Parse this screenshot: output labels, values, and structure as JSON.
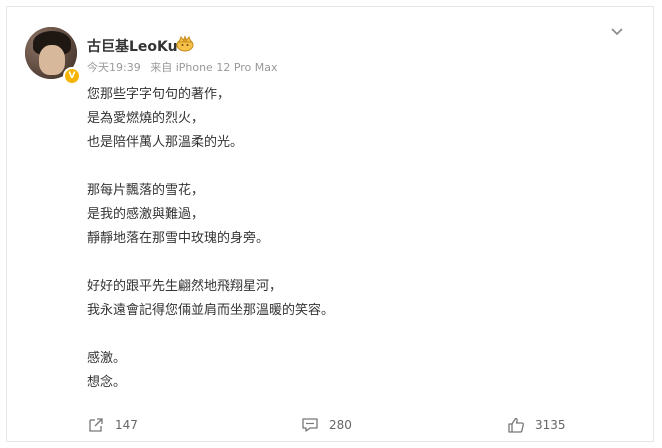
{
  "post": {
    "author": {
      "name": "古巨基LeoKu"
    },
    "meta": {
      "time": "今天19:39",
      "source": "来自 iPhone 12 Pro Max"
    },
    "lines": [
      "您那些字字句句的著作，",
      "是為愛燃燒的烈火，",
      "也是陪伴萬人那溫柔的光。",
      "",
      "那每片飄落的雪花，",
      "是我的感激與難過，",
      "靜靜地落在那雪中玫瑰的身旁。",
      "",
      "好好的跟平先生翩然地飛翔星河，",
      "我永遠會記得您倆並肩而坐那溫暖的笑容。",
      "",
      "感激。",
      "想念。"
    ],
    "actions": {
      "share_count": "147",
      "comment_count": "280",
      "like_count": "3135"
    },
    "icons": {
      "share": "share-icon",
      "comment": "comment-icon",
      "like": "thumbs-up-icon",
      "menu": "chevron-down-icon",
      "member": "member-crown-icon",
      "verified": "verified-badge-icon"
    },
    "colors": {
      "verified_badge": "#f4b400",
      "meta_text": "#999999",
      "body_text": "#333333"
    }
  }
}
